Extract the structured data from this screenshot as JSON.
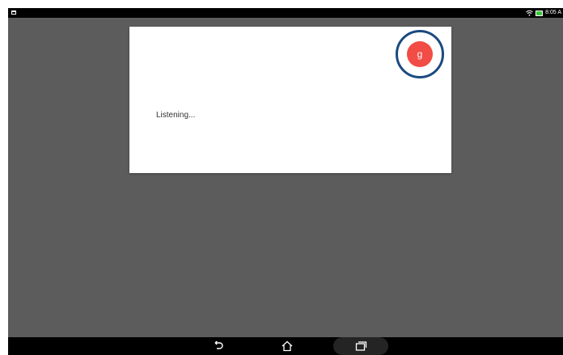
{
  "status_bar": {
    "time": "8:05 A",
    "notification_icon": "notification-icon",
    "wifi_icon": "wifi-icon",
    "battery_icon": "battery-charging-icon"
  },
  "voice_search": {
    "status_text": "Listening...",
    "mic_glyph": "g",
    "mic_icon": "google-mic-icon",
    "accent_color": "#f14c45",
    "highlight_color": "#1b4a80"
  },
  "nav_bar": {
    "back_icon": "back-icon",
    "home_icon": "home-icon",
    "recent_icon": "recent-apps-icon"
  }
}
